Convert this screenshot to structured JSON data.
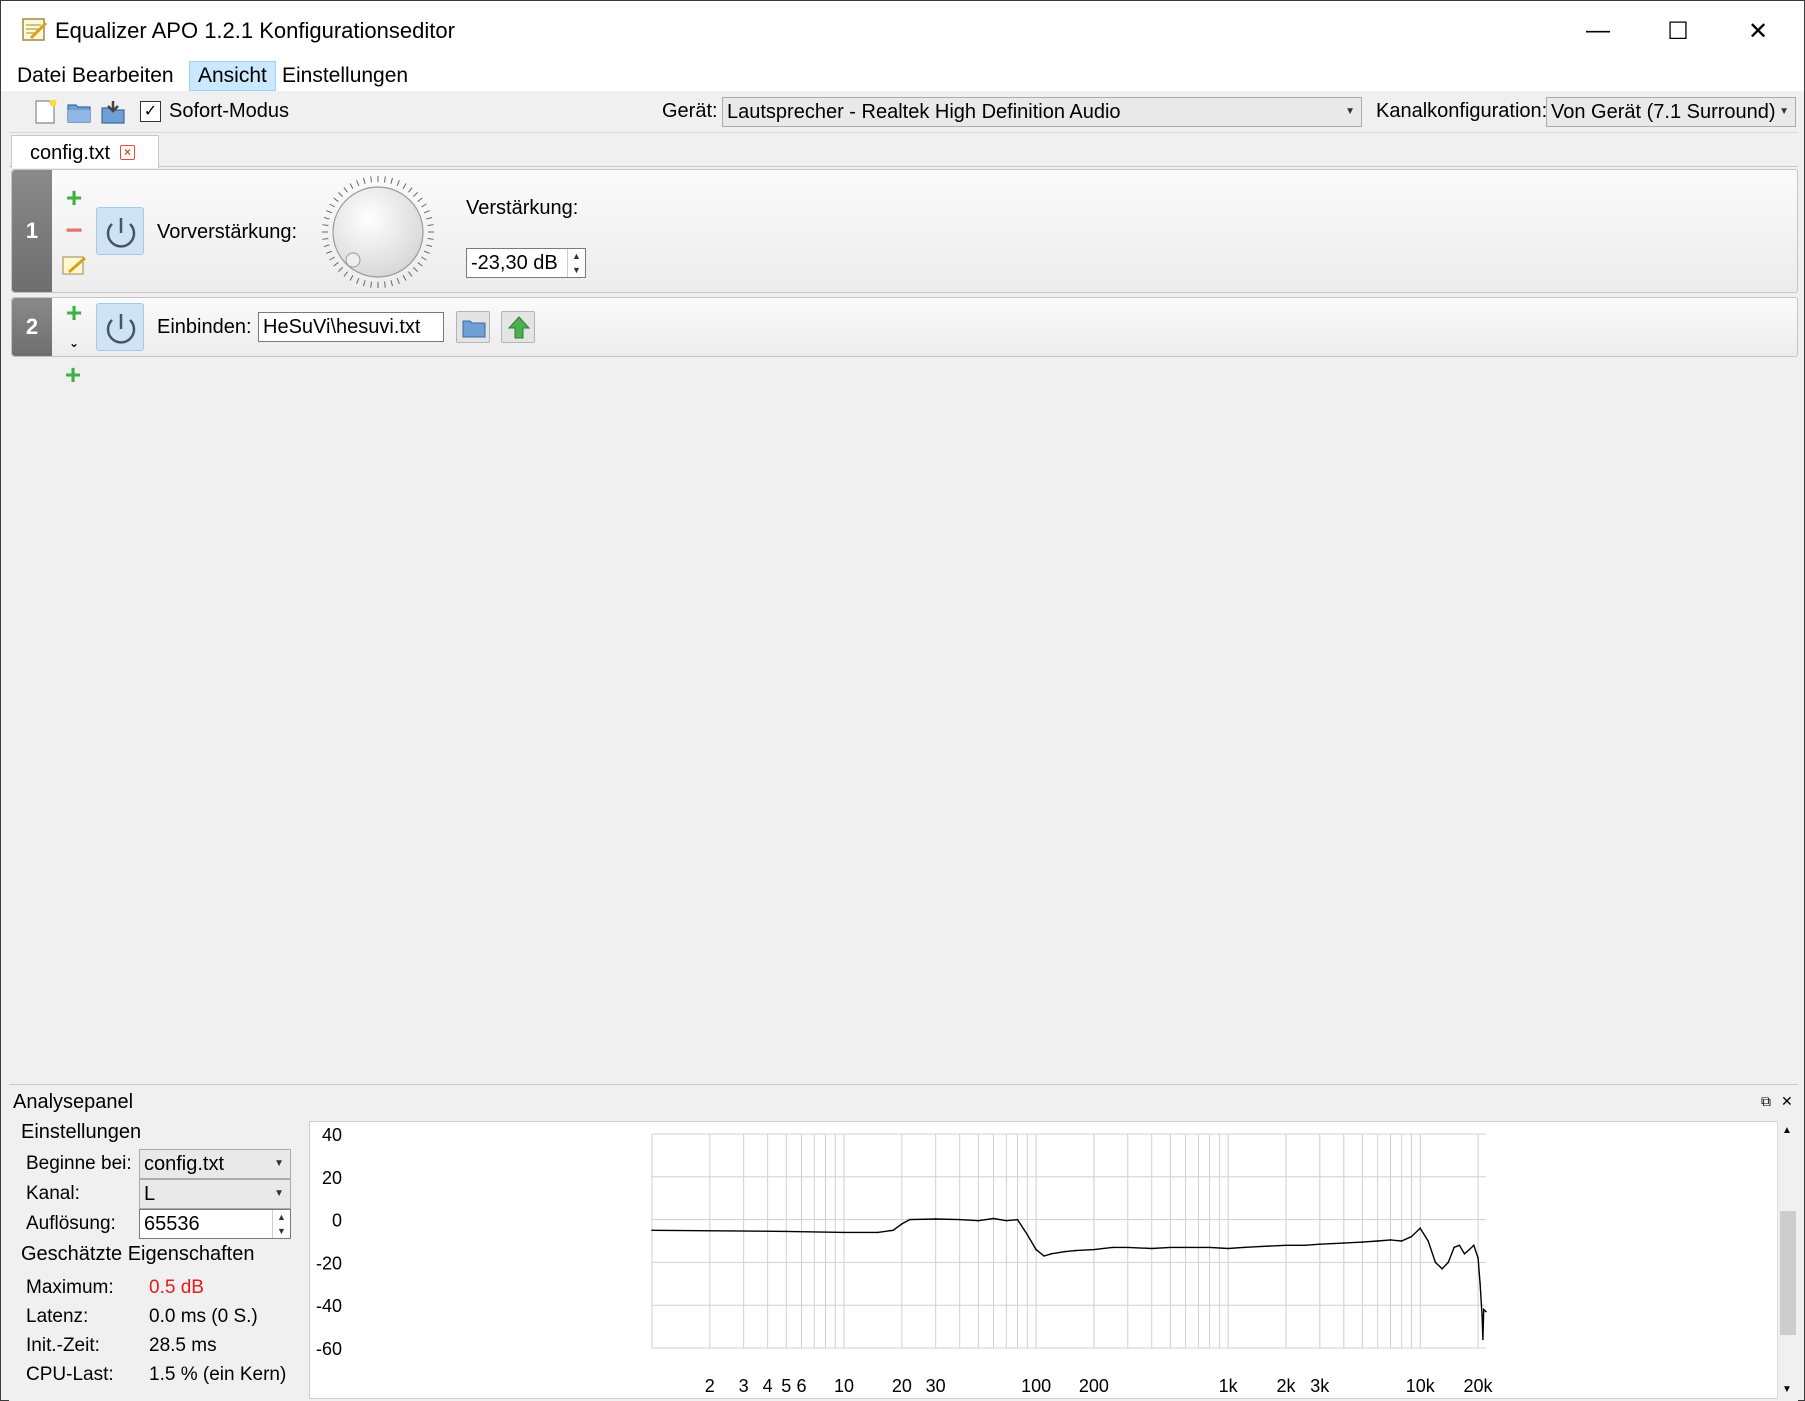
{
  "window": {
    "title": "Equalizer APO 1.2.1 Konfigurationseditor",
    "minimize": "—",
    "maximize": "☐",
    "close": "✕"
  },
  "menu": [
    "Datei",
    "Bearbeiten",
    "Ansicht",
    "Einstellungen"
  ],
  "toolbar": {
    "instant_mode_label": "Sofort-Modus",
    "instant_mode_checked": true,
    "device_label": "Gerät:",
    "device_value": "Lautsprecher - Realtek High Definition Audio",
    "channel_config_label": "Kanalkonfiguration:",
    "channel_config_value": "Von Gerät (7.1 Surround)"
  },
  "tab": {
    "label": "config.txt"
  },
  "filters": [
    {
      "number": "1",
      "type_label": "Vorverstärkung:",
      "gain_label": "Verstärkung:",
      "gain_value": "-23,30 dB"
    },
    {
      "number": "2",
      "type_label": "Einbinden:",
      "path_value": "HeSuVi\\hesuvi.txt"
    }
  ],
  "analysis": {
    "title": "Analysepanel",
    "settings_title": "Einstellungen",
    "start_label": "Beginne bei:",
    "start_value": "config.txt",
    "channel_label": "Kanal:",
    "channel_value": "L",
    "resolution_label": "Auflösung:",
    "resolution_value": "65536",
    "estimated_title": "Geschätzte Eigenschaften",
    "max_label": "Maximum:",
    "max_value": "0.5 dB",
    "latency_label": "Latenz:",
    "latency_value": "0.0 ms (0 S.)",
    "init_label": "Init.-Zeit:",
    "init_value": "28.5 ms",
    "cpu_label": "CPU-Last:",
    "cpu_value": "1.5 % (ein Kern)",
    "colors": {
      "max_value": "#e21b1b",
      "curve": "#000000",
      "grid": "#d0d0d0"
    }
  },
  "chart_data": {
    "type": "line",
    "title": "",
    "xlabel": "",
    "ylabel": "",
    "x_scale": "log",
    "grid": true,
    "xlim": [
      1,
      22000
    ],
    "ylim": [
      -60,
      40
    ],
    "y_ticks": [
      "40",
      "20",
      "0",
      "-20",
      "-40",
      "-60"
    ],
    "y_tick_values": [
      40,
      20,
      0,
      -20,
      -40,
      -60
    ],
    "x_ticks": [
      "2",
      "3",
      "4",
      "5",
      "6",
      "10",
      "20",
      "30",
      "100",
      "200",
      "1k",
      "2k",
      "3k",
      "10k",
      "20k"
    ],
    "x_tick_values": [
      2,
      3,
      4,
      5,
      6,
      10,
      20,
      30,
      100,
      200,
      1000,
      2000,
      3000,
      10000,
      20000
    ],
    "series": [
      {
        "points": [
          [
            1,
            -5
          ],
          [
            5,
            -5.5
          ],
          [
            10,
            -6
          ],
          [
            15,
            -6
          ],
          [
            18,
            -5
          ],
          [
            20,
            -2
          ],
          [
            22,
            0
          ],
          [
            30,
            0.3
          ],
          [
            40,
            0
          ],
          [
            50,
            -0.5
          ],
          [
            60,
            0.5
          ],
          [
            70,
            -0.5
          ],
          [
            80,
            0
          ],
          [
            90,
            -7
          ],
          [
            100,
            -14
          ],
          [
            110,
            -17
          ],
          [
            120,
            -16
          ],
          [
            140,
            -15
          ],
          [
            160,
            -14.5
          ],
          [
            200,
            -14
          ],
          [
            250,
            -13
          ],
          [
            300,
            -13
          ],
          [
            400,
            -13.5
          ],
          [
            500,
            -13
          ],
          [
            600,
            -13
          ],
          [
            800,
            -13
          ],
          [
            1000,
            -13.5
          ],
          [
            1200,
            -13
          ],
          [
            1500,
            -12.5
          ],
          [
            2000,
            -12
          ],
          [
            2500,
            -12
          ],
          [
            3000,
            -11.5
          ],
          [
            4000,
            -11
          ],
          [
            5000,
            -10.5
          ],
          [
            6000,
            -10
          ],
          [
            7000,
            -9.5
          ],
          [
            8000,
            -10
          ],
          [
            9000,
            -8
          ],
          [
            10000,
            -4
          ],
          [
            11000,
            -10
          ],
          [
            12000,
            -20
          ],
          [
            13000,
            -23
          ],
          [
            14000,
            -20
          ],
          [
            15000,
            -13
          ],
          [
            16000,
            -12
          ],
          [
            17000,
            -16
          ],
          [
            18000,
            -14
          ],
          [
            19000,
            -12
          ],
          [
            20000,
            -18
          ],
          [
            20500,
            -30
          ],
          [
            21000,
            -45
          ],
          [
            21200,
            -56
          ],
          [
            21400,
            -42
          ],
          [
            22000,
            -43
          ]
        ]
      }
    ]
  }
}
